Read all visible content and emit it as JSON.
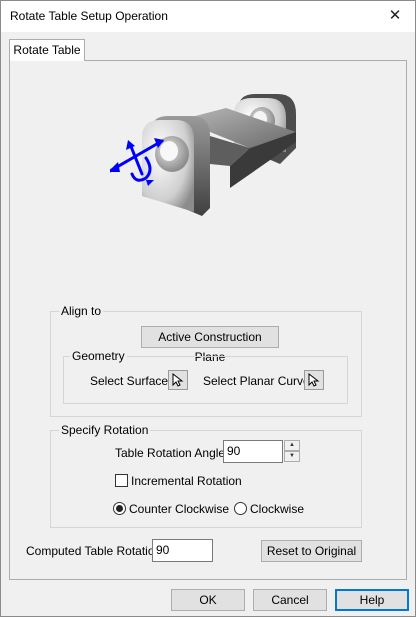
{
  "window": {
    "title": "Rotate Table Setup Operation",
    "close_glyph": "✕"
  },
  "tabs": [
    {
      "label": "Rotate Table",
      "selected": true
    }
  ],
  "preview": {
    "icon": "rotate-table-part-preview",
    "arrow_color": "#0000ff"
  },
  "align_to": {
    "group_label": "Align to",
    "active_construction_plane_label": "Active Construction Plane",
    "geometry": {
      "group_label": "Geometry",
      "select_surface_label": "Select Surface:",
      "select_planar_curve_label": "Select Planar Curve:"
    }
  },
  "specify_rotation": {
    "group_label": "Specify Rotation",
    "angle_label": "Table Rotation Angle:",
    "angle_value": "90",
    "incremental_label": "Incremental Rotation",
    "incremental_checked": false,
    "direction_options": [
      "Counter Clockwise",
      "Clockwise"
    ],
    "direction_selected": "Counter Clockwise"
  },
  "computed": {
    "label": "Computed Table Rotation:",
    "value": "90",
    "reset_label": "Reset to Original"
  },
  "footer": {
    "ok_label": "OK",
    "cancel_label": "Cancel",
    "help_label": "Help"
  }
}
